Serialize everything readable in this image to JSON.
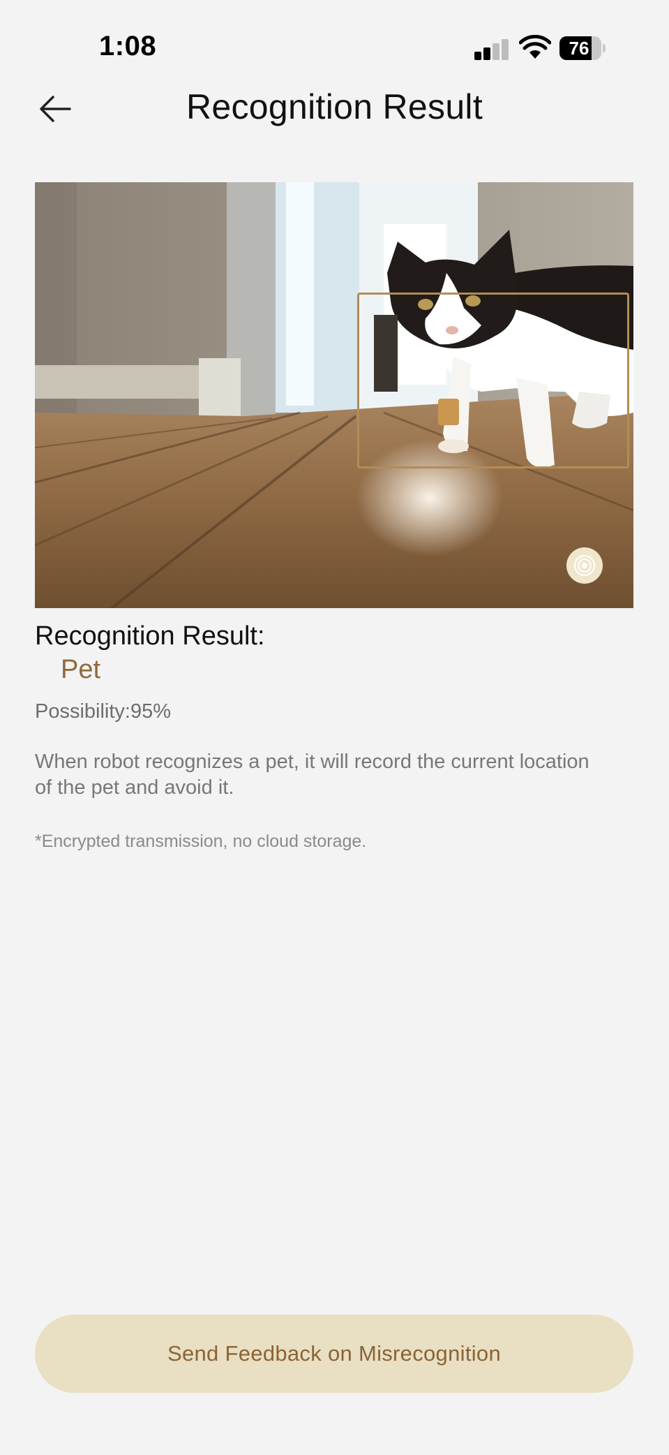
{
  "status_bar": {
    "time": "1:08",
    "battery_level": "76",
    "battery_percent": 76,
    "signal_bars_active": 2,
    "signal_bars_total": 4
  },
  "nav": {
    "title": "Recognition Result",
    "back_icon": "arrow-left-icon"
  },
  "photo": {
    "subject": "cat",
    "detection_box_color": "#b08d57",
    "lens_icon": "lens-icon"
  },
  "result": {
    "label": "Recognition Result:",
    "value": "Pet",
    "possibility_label": "Possibility:",
    "possibility_value": "95%",
    "description": "When robot recognizes a pet, it will record the current location of the pet and avoid it.",
    "privacy_note": "*Encrypted transmission, no cloud storage."
  },
  "actions": {
    "feedback_label": "Send Feedback on Misrecognition"
  },
  "colors": {
    "background": "#f3f3f4",
    "accent": "#8f6a3a",
    "button_bg": "#e9dfc3"
  }
}
